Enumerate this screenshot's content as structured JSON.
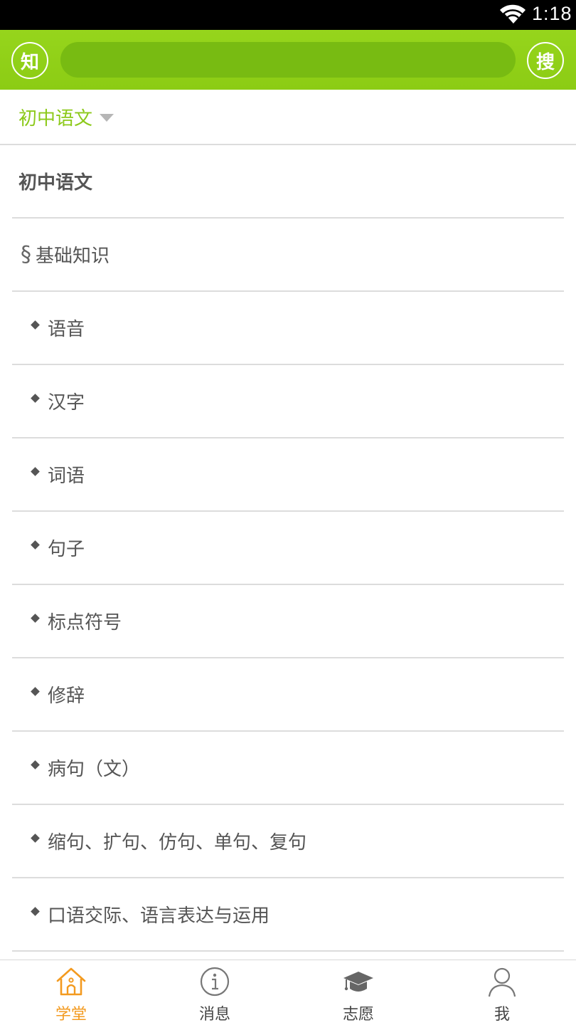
{
  "status_bar": {
    "time": "1:18"
  },
  "header": {
    "logo_label": "知",
    "search_button_label": "搜",
    "search_placeholder": ""
  },
  "subject_selector": {
    "label": "初中语文"
  },
  "list": {
    "title": "初中语文",
    "section": {
      "symbol": "§",
      "label": "基础知识"
    },
    "items": [
      "语音",
      "汉字",
      "词语",
      "句子",
      "标点符号",
      "修辞",
      "病句（文）",
      "缩句、扩句、仿句、单句、复句",
      "口语交际、语言表达与运用"
    ]
  },
  "tabbar": {
    "tabs": [
      {
        "label": "学堂",
        "icon": "home-icon",
        "active": true
      },
      {
        "label": "消息",
        "icon": "info-icon",
        "active": false
      },
      {
        "label": "志愿",
        "icon": "graduation-cap-icon",
        "active": false
      },
      {
        "label": "我",
        "icon": "user-icon",
        "active": false
      }
    ]
  },
  "colors": {
    "brand_green": "#8ccc14",
    "search_bar": "#78bb12",
    "active_tab": "#f39a1f"
  }
}
